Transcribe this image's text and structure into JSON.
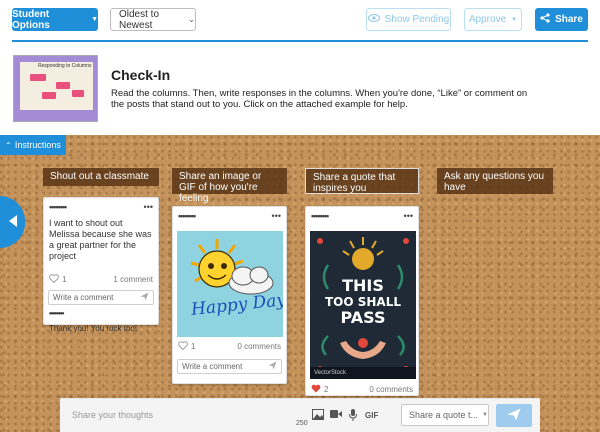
{
  "toolbar": {
    "student_options": "Student Options",
    "sort_value": "Oldest to Newest",
    "show_pending": "Show Pending",
    "approve": "Approve",
    "share": "Share"
  },
  "header": {
    "title": "Check-In",
    "description": "Read the columns. Then, write responses in the columns. When you're done, “Like” or comment on the posts that stand out to you. Click on the attached example for help.",
    "thumbnail_caption": "Responding to Columns"
  },
  "instructions_tab": "Instructions",
  "columns": [
    {
      "title": "Shout out a classmate"
    },
    {
      "title": "Share an image or GIF of how you're feeling"
    },
    {
      "title": "Share a quote that inspires you"
    },
    {
      "title": "Ask any questions you have"
    }
  ],
  "cards": {
    "shout": {
      "author": "••••••••",
      "text": "I want to shout out Melissa because she was a great partner for the project",
      "likes": "1",
      "comments": "1 comment",
      "comment_placeholder": "Write a comment",
      "reply_author": "••••••••",
      "reply_text": "Thank you! You rock too!"
    },
    "image": {
      "author": "••••••••",
      "image_text": "Happy Day",
      "likes": "1",
      "comments": "0 comments",
      "comment_placeholder": "Write a comment"
    },
    "quote": {
      "author": "••••••••",
      "image_lines": [
        "THIS",
        "TOO SHALL",
        "PASS"
      ],
      "watermark": "VectorStock",
      "likes": "2",
      "comments": "0 comments"
    }
  },
  "compose": {
    "placeholder": "Share your thoughts",
    "char_count": "250",
    "gif": "GIF",
    "select_value": "Share a quote t..."
  },
  "colors": {
    "primary": "#1e8fd8",
    "cork": "#c4935c",
    "column_header": "#5a3415"
  }
}
